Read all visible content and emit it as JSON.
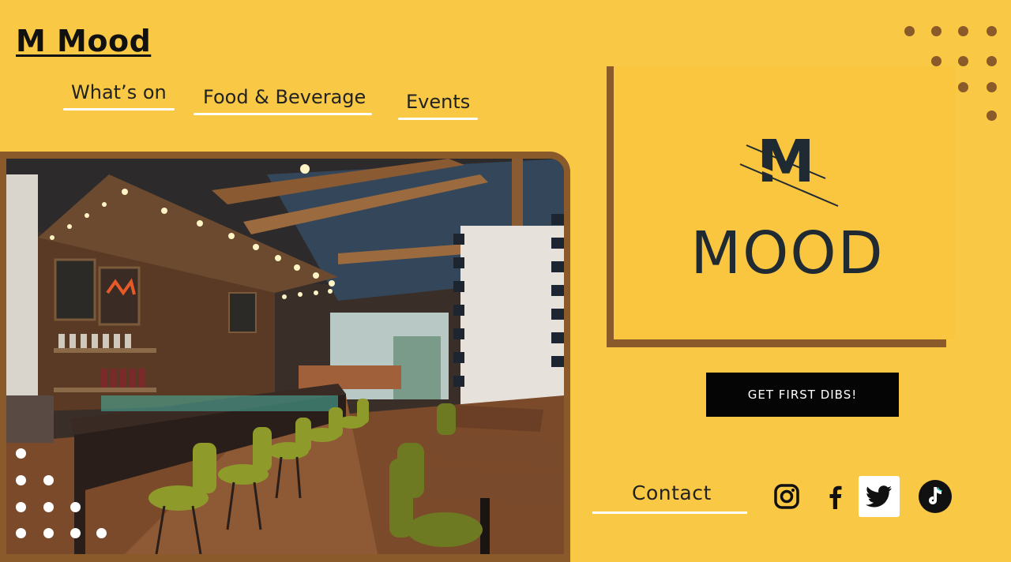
{
  "brand": {
    "title": "M Mood"
  },
  "nav": [
    {
      "label": "What’s on"
    },
    {
      "label": "Food & Beverage"
    },
    {
      "label": "Events"
    }
  ],
  "logo": {
    "letter": "M",
    "word": "MOOD"
  },
  "cta": {
    "label": "GET FIRST DIBS!"
  },
  "footer": {
    "contact_label": "Contact"
  },
  "social": [
    "instagram-icon",
    "facebook-icon",
    "twitter-icon",
    "tiktok-icon"
  ],
  "colors": {
    "background": "#f9c844",
    "accent_brown": "#8b5a2b",
    "dark": "#050505",
    "logo_ink": "#1f2a33"
  }
}
